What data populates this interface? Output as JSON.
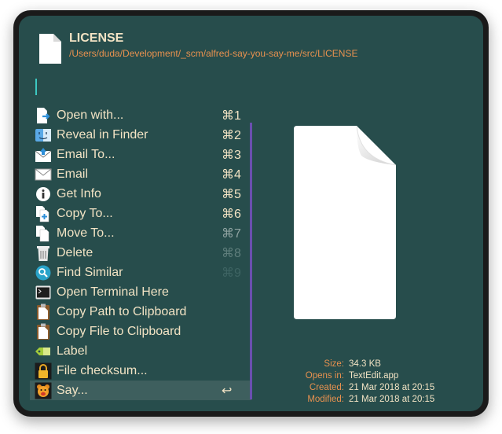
{
  "header": {
    "title": "LICENSE",
    "path": "/Users/duda/Development/_scm/alfred-say-you-say-me/src/LICENSE"
  },
  "actions": [
    {
      "label": "Open with...",
      "shortcut": "⌘1",
      "icon": "open-with-icon"
    },
    {
      "label": "Reveal in Finder",
      "shortcut": "⌘2",
      "icon": "finder-icon"
    },
    {
      "label": "Email To...",
      "shortcut": "⌘3",
      "icon": "email-to-icon"
    },
    {
      "label": "Email",
      "shortcut": "⌘4",
      "icon": "envelope-icon"
    },
    {
      "label": "Get Info",
      "shortcut": "⌘5",
      "icon": "info-icon"
    },
    {
      "label": "Copy To...",
      "shortcut": "⌘6",
      "icon": "copy-to-icon"
    },
    {
      "label": "Move To...",
      "shortcut": "⌘7",
      "icon": "move-to-icon"
    },
    {
      "label": "Delete",
      "shortcut": "⌘8",
      "icon": "trash-icon"
    },
    {
      "label": "Find Similar",
      "shortcut": "⌘9",
      "icon": "magnifier-icon"
    },
    {
      "label": "Open Terminal Here",
      "shortcut": "",
      "icon": "terminal-icon"
    },
    {
      "label": "Copy Path to Clipboard",
      "shortcut": "",
      "icon": "clipboard-path-icon"
    },
    {
      "label": "Copy File to Clipboard",
      "shortcut": "",
      "icon": "clipboard-file-icon"
    },
    {
      "label": "Label",
      "shortcut": "",
      "icon": "label-tag-icon"
    },
    {
      "label": "File checksum...",
      "shortcut": "",
      "icon": "lock-icon"
    },
    {
      "label": "Say...",
      "shortcut": "↩",
      "icon": "say-bear-icon",
      "selected": true
    }
  ],
  "meta": {
    "size_key": "Size:",
    "size_val": "34.3 KB",
    "opens_key": "Opens in:",
    "opens_val": "TextEdit.app",
    "created_key": "Created:",
    "created_val": "21 Mar 2018 at 20:15",
    "modified_key": "Modified:",
    "modified_val": "21 Mar 2018 at 20:15"
  },
  "colors": {
    "background": "#274d4c",
    "text": "#f2e3c4",
    "accent": "#e7914f",
    "scrollbar": "#6a4fb0",
    "caret": "#3dc9c2"
  }
}
